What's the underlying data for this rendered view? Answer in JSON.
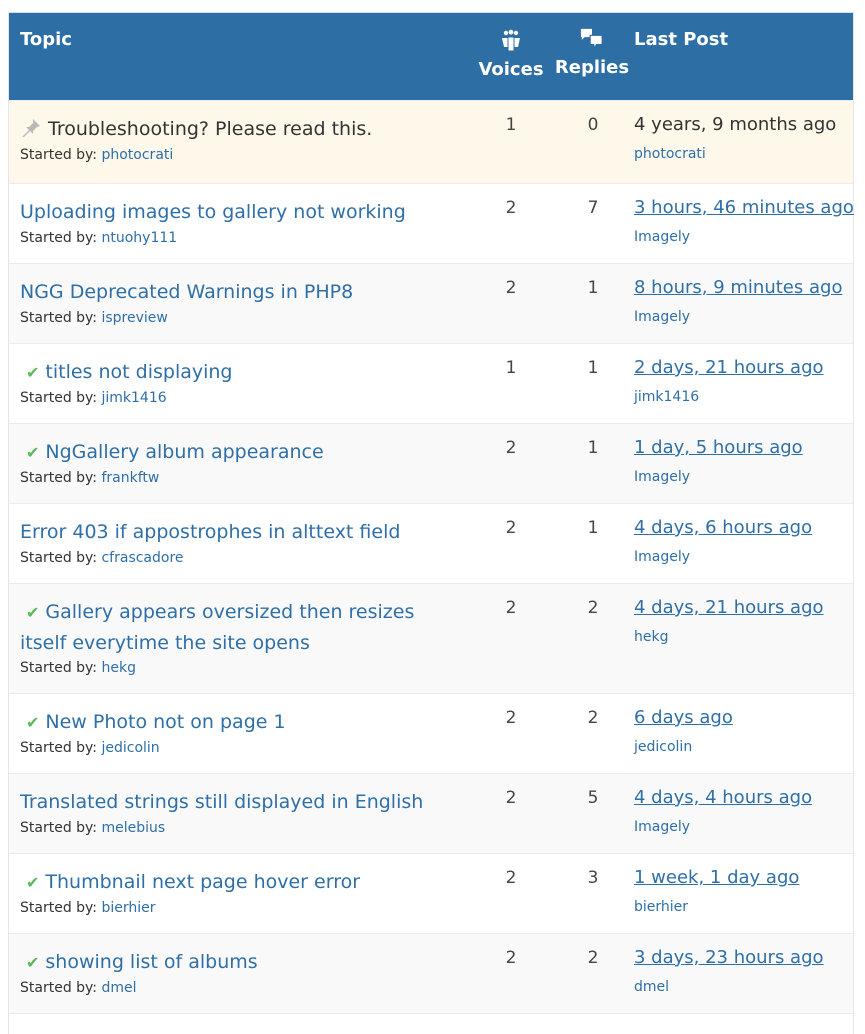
{
  "header": {
    "topic": "Topic",
    "voices": "Voices",
    "replies": "Replies",
    "last_post": "Last Post",
    "voices_icon": "group-icon",
    "replies_icon": "speech-bubbles-icon"
  },
  "started_by_label": "Started by:",
  "colors": {
    "header_bg": "#2d6ea5",
    "link": "#2e6fa7",
    "sticky_bg": "#fdf8e9",
    "resolved_check": "#5cb85c"
  },
  "topics": [
    {
      "title": "Troubleshooting? Please read this.",
      "author": "photocrati",
      "voices": "1",
      "replies": "0",
      "last_time": "4 years, 9 months ago",
      "last_by": "photocrati",
      "sticky": true,
      "resolved": false
    },
    {
      "title": "Uploading images to gallery not working",
      "author": "ntuohy111",
      "voices": "2",
      "replies": "7",
      "last_time": "3 hours, 46 minutes ago",
      "last_by": "Imagely",
      "sticky": false,
      "resolved": false
    },
    {
      "title": "NGG Deprecated Warnings in PHP8",
      "author": "ispreview",
      "voices": "2",
      "replies": "1",
      "last_time": "8 hours, 9 minutes ago",
      "last_by": "Imagely",
      "sticky": false,
      "resolved": false
    },
    {
      "title": "titles not displaying",
      "author": "jimk1416",
      "voices": "1",
      "replies": "1",
      "last_time": "2 days, 21 hours ago",
      "last_by": "jimk1416",
      "sticky": false,
      "resolved": true
    },
    {
      "title": "NgGallery album appearance",
      "author": "frankftw",
      "voices": "2",
      "replies": "1",
      "last_time": "1 day, 5 hours ago",
      "last_by": "Imagely",
      "sticky": false,
      "resolved": true
    },
    {
      "title": "Error 403 if appostrophes in alttext field",
      "author": "cfrascadore",
      "voices": "2",
      "replies": "1",
      "last_time": "4 days, 6 hours ago",
      "last_by": "Imagely",
      "sticky": false,
      "resolved": false
    },
    {
      "title": "Gallery appears oversized then resizes itself everytime the site opens",
      "author": "hekg",
      "voices": "2",
      "replies": "2",
      "last_time": "4 days, 21 hours ago",
      "last_by": "hekg",
      "sticky": false,
      "resolved": true
    },
    {
      "title": "New Photo not on page 1",
      "author": "jedicolin",
      "voices": "2",
      "replies": "2",
      "last_time": "6 days ago",
      "last_by": "jedicolin",
      "sticky": false,
      "resolved": true
    },
    {
      "title": "Translated strings still displayed in English",
      "author": "melebius",
      "voices": "2",
      "replies": "5",
      "last_time": "4 days, 4 hours ago",
      "last_by": "Imagely",
      "sticky": false,
      "resolved": false
    },
    {
      "title": "Thumbnail next page hover error",
      "author": "bierhier",
      "voices": "2",
      "replies": "3",
      "last_time": "1 week, 1 day ago",
      "last_by": "bierhier",
      "sticky": false,
      "resolved": true
    },
    {
      "title": "showing list of albums",
      "author": "dmel",
      "voices": "2",
      "replies": "2",
      "last_time": "3 days, 23 hours ago",
      "last_by": "dmel",
      "sticky": false,
      "resolved": true
    }
  ]
}
